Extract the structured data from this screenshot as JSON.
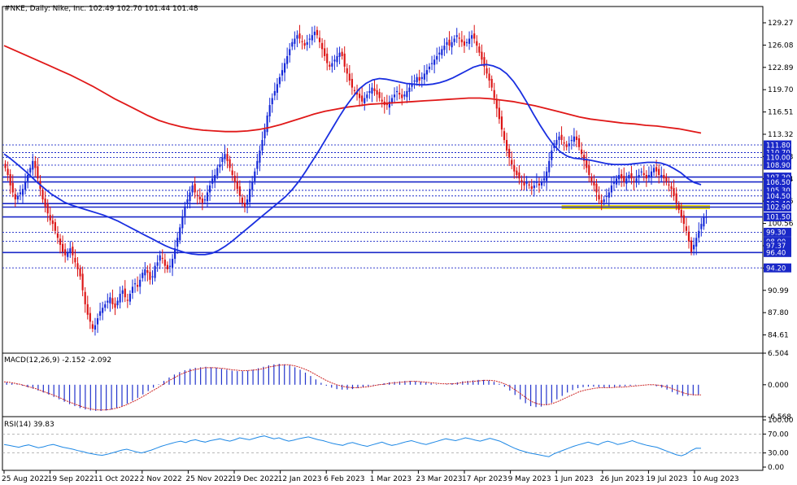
{
  "header": {
    "symbol": "#NKE",
    "timeframe": "Daily",
    "name": "Nike, Inc.",
    "ohlc": "102.49 102.70 101.44 101.48"
  },
  "colors": {
    "up": "#1428d8",
    "down": "#dc1414",
    "ma_fast": "#1a2fe0",
    "ma_slow": "#e01818",
    "level_tag": "#1a28c8",
    "highlight": "#e6d400",
    "macd_hist": "#2233cc",
    "macd_signal": "#cc2222",
    "rsi": "#1e88e5",
    "grid_dots": "#9090a0"
  },
  "chart_data": [
    {
      "type": "candlestick",
      "title": "#NKE, Daily: Nike, Inc. 102.49 102.70 101.44 101.48",
      "ylim": [
        82.0,
        131.6
      ],
      "y_ticks": [
        "129.27",
        "126.08",
        "122.89",
        "119.70",
        "116.51",
        "113.32",
        "110.13",
        "106.94",
        "103.76",
        "100.56",
        "97.37",
        "94.18",
        "90.99",
        "87.80",
        "84.61"
      ],
      "x_ticks": [
        "25 Aug 2022",
        "19 Sep 2022",
        "11 Oct 2022",
        "2 Nov 2022",
        "25 Nov 2022",
        "19 Dec 2022",
        "12 Jan 2023",
        "6 Feb 2023",
        "1 Mar 2023",
        "23 Mar 2023",
        "17 Apr 2023",
        "9 May 2023",
        "1 Jun 2023",
        "26 Jun 2023",
        "19 Jul 2023",
        "10 Aug 2023"
      ],
      "horizontal_levels": [
        {
          "label": "111.80",
          "value": 111.8,
          "style": "dotted"
        },
        {
          "label": "110.70",
          "value": 110.7,
          "style": "dotted"
        },
        {
          "label": "110.00",
          "value": 110.0,
          "style": "dotted"
        },
        {
          "label": "108.90",
          "value": 108.9,
          "style": "dotted"
        },
        {
          "label": "107.20",
          "value": 107.2,
          "style": "solid"
        },
        {
          "label": "106.50",
          "value": 106.5,
          "style": "solid"
        },
        {
          "label": "105.30",
          "value": 105.3,
          "style": "dotted"
        },
        {
          "label": "104.50",
          "value": 104.5,
          "style": "dotted"
        },
        {
          "label": "103.40",
          "value": 103.4,
          "style": "solid"
        },
        {
          "label": "102.90",
          "value": 102.9,
          "style": "solid"
        },
        {
          "label": "101.50",
          "value": 101.5,
          "style": "solid"
        },
        {
          "label": "99.30",
          "value": 99.3,
          "style": "dotted"
        },
        {
          "label": "98.00",
          "value": 98.0,
          "style": "dotted"
        },
        {
          "label": "97.37",
          "value": 97.37,
          "style": "none"
        },
        {
          "label": "96.40",
          "value": 96.4,
          "style": "solid"
        },
        {
          "label": "94.20",
          "value": 94.2,
          "style": "dotted"
        }
      ],
      "highlight_level": 102.9,
      "close_series": [
        108.5,
        107.5,
        106,
        105,
        104,
        104.5,
        105,
        105.5,
        106.5,
        107.5,
        108.5,
        109.5,
        108.5,
        107,
        105.5,
        104,
        103,
        102,
        101,
        100.5,
        99.5,
        98.5,
        97.5,
        96.5,
        96,
        96.5,
        97,
        96,
        95,
        94,
        93,
        91,
        89,
        87.5,
        86.5,
        85.5,
        86,
        87,
        88,
        88.5,
        89,
        89.5,
        90,
        89,
        88.5,
        89.5,
        90.5,
        91,
        90,
        89.5,
        90.5,
        91.5,
        92,
        91.5,
        92.5,
        93.5,
        94,
        93.5,
        92.5,
        93,
        94.5,
        95,
        96,
        95.5,
        94.5,
        94,
        94.5,
        95.5,
        97,
        98.5,
        100,
        101.5,
        103,
        104,
        105,
        106,
        105,
        104.5,
        104,
        103.5,
        104,
        105,
        106,
        107,
        107.5,
        108.5,
        109,
        110,
        110.5,
        109.5,
        108.5,
        107.5,
        106.5,
        105.5,
        104.5,
        103.5,
        103,
        104,
        105.5,
        106.5,
        108,
        109.5,
        111,
        112.5,
        114,
        116,
        117.5,
        118.5,
        119.5,
        120.5,
        121.5,
        122.5,
        123.5,
        124.5,
        125.5,
        126.5,
        127,
        127.5,
        127,
        126.5,
        126,
        126.5,
        127,
        127.5,
        128,
        127.5,
        126.5,
        125.5,
        124.5,
        123.5,
        123,
        123.5,
        124,
        124.5,
        125,
        124.5,
        123,
        122,
        121,
        120,
        119.5,
        119,
        118.5,
        118,
        118.5,
        119,
        119.5,
        120,
        119.5,
        119,
        118.5,
        118,
        117.5,
        117.5,
        118,
        118.5,
        119,
        119.5,
        119,
        118.5,
        119,
        119.5,
        120,
        120.5,
        121,
        121.5,
        121,
        121.5,
        122,
        122.5,
        123,
        123.5,
        124,
        124.5,
        125,
        125.5,
        126,
        126.5,
        126,
        126.5,
        127,
        127.5,
        127,
        126.5,
        126,
        126.5,
        127,
        127.5,
        127,
        126,
        125,
        124,
        123,
        122,
        121,
        120,
        118.5,
        117,
        115.5,
        114,
        112.5,
        111,
        110,
        109,
        108,
        107.5,
        107,
        106.5,
        106,
        106.5,
        106,
        105.5,
        106,
        106.5,
        106,
        106.5,
        107,
        108,
        109.5,
        111,
        112,
        112.5,
        113,
        112.5,
        112,
        111.5,
        112,
        112.5,
        113,
        112.5,
        111.5,
        110.5,
        109.5,
        108.5,
        107.5,
        106.5,
        106,
        105,
        104,
        103.5,
        104,
        104.5,
        105,
        106,
        106.5,
        107,
        107.5,
        107,
        106.5,
        107,
        107.5,
        107,
        106.5,
        107,
        107.5,
        108,
        107.5,
        107,
        107.5,
        108,
        108.5,
        108,
        107.5,
        107.5,
        107,
        106.5,
        106,
        105.5,
        104.5,
        103.5,
        102.5,
        101.5,
        100.5,
        99.5,
        98,
        96.5,
        97.5,
        98.5,
        99.5,
        100.5,
        101.5,
        101.48
      ],
      "ma_fast": {
        "name": "",
        "values": [
          110.5,
          109.8,
          109.0,
          108.2,
          107.3,
          106.4,
          105.6,
          104.8,
          104.2,
          103.6,
          103.2,
          102.9,
          102.6,
          102.3,
          102.0,
          101.7,
          101.3,
          100.9,
          100.4,
          99.9,
          99.4,
          98.9,
          98.4,
          97.9,
          97.4,
          97.0,
          96.7,
          96.4,
          96.2,
          96.1,
          96.1,
          96.3,
          96.7,
          97.3,
          98.0,
          98.8,
          99.6,
          100.4,
          101.2,
          102.0,
          102.8,
          103.6,
          104.4,
          105.4,
          106.6,
          108.0,
          109.5,
          111.0,
          112.6,
          114.2,
          115.8,
          117.3,
          118.6,
          119.8,
          120.6,
          121.1,
          121.3,
          121.2,
          121.0,
          120.8,
          120.6,
          120.5,
          120.4,
          120.4,
          120.5,
          120.7,
          121.0,
          121.4,
          121.9,
          122.4,
          122.9,
          123.2,
          123.3,
          123.1,
          122.7,
          122.0,
          120.9,
          119.5,
          117.9,
          116.2,
          114.6,
          113.1,
          111.8,
          110.8,
          110.2,
          109.9,
          109.8,
          109.7,
          109.5,
          109.3,
          109.1,
          109.0,
          109.0,
          109.0,
          109.1,
          109.2,
          109.3,
          109.3,
          109.2,
          108.9,
          108.4,
          107.8,
          107.0,
          106.4,
          106.1
        ]
      },
      "ma_slow": {
        "name": "",
        "values": [
          126.0,
          125.3,
          124.6,
          123.9,
          123.2,
          122.5,
          121.8,
          121.0,
          120.2,
          119.3,
          118.4,
          117.6,
          116.8,
          116.0,
          115.3,
          114.8,
          114.4,
          114.1,
          113.9,
          113.8,
          113.7,
          113.7,
          113.8,
          114.0,
          114.3,
          114.7,
          115.2,
          115.7,
          116.2,
          116.6,
          116.9,
          117.2,
          117.4,
          117.6,
          117.7,
          117.8,
          117.9,
          118.0,
          118.1,
          118.2,
          118.3,
          118.4,
          118.5,
          118.5,
          118.4,
          118.2,
          118.0,
          117.7,
          117.4,
          117.0,
          116.6,
          116.2,
          115.8,
          115.5,
          115.3,
          115.1,
          114.9,
          114.8,
          114.6,
          114.5,
          114.3,
          114.1,
          113.8,
          113.5
        ]
      },
      "note_candles": "candles are drawn from close_series"
    },
    {
      "type": "bar",
      "title": "MACD(12,26,9) -2.152 -2.092",
      "ylim": [
        -6.568,
        6.504
      ],
      "y_ticks": [
        "6.504",
        "0.000",
        "-6.568"
      ],
      "series": [
        {
          "name": "",
          "values": [
            0.5,
            0.3,
            0.1,
            -0.2,
            -0.5,
            -0.8,
            -1.2,
            -1.6,
            -2.0,
            -2.5,
            -3.0,
            -3.5,
            -4.0,
            -4.4,
            -4.8,
            -5.1,
            -5.3,
            -5.4,
            -5.4,
            -5.3,
            -5.1,
            -4.8,
            -4.4,
            -3.9,
            -3.3,
            -2.7,
            -2.0,
            -1.3,
            -0.6,
            0.1,
            0.8,
            1.5,
            2.1,
            2.6,
            3.0,
            3.3,
            3.5,
            3.6,
            3.7,
            3.6,
            3.5,
            3.3,
            3.1,
            2.9,
            2.8,
            2.8,
            2.9,
            3.1,
            3.4,
            3.7,
            4.0,
            4.2,
            4.3,
            4.2,
            4.0,
            3.6,
            3.1,
            2.5,
            1.8,
            1.1,
            0.4,
            -0.2,
            -0.6,
            -0.9,
            -1.0,
            -1.0,
            -0.9,
            -0.7,
            -0.5,
            -0.3,
            -0.1,
            0.1,
            0.3,
            0.5,
            0.6,
            0.7,
            0.8,
            0.8,
            0.7,
            0.6,
            0.5,
            0.3,
            0.1,
            0.0,
            0.1,
            0.3,
            0.5,
            0.7,
            0.8,
            0.9,
            1.0,
            1.0,
            0.9,
            0.6,
            0.2,
            -0.4,
            -1.2,
            -2.1,
            -3.0,
            -3.8,
            -4.4,
            -4.6,
            -4.5,
            -4.2,
            -3.7,
            -3.0,
            -2.3,
            -1.6,
            -1.1,
            -0.7,
            -0.5,
            -0.4,
            -0.4,
            -0.5,
            -0.6,
            -0.6,
            -0.5,
            -0.4,
            -0.3,
            -0.2,
            -0.1,
            0.0,
            0.0,
            -0.1,
            -0.3,
            -0.6,
            -1.0,
            -1.5,
            -2.0,
            -2.3,
            -2.3,
            -2.2,
            -2.15
          ]
        },
        {
          "name": "",
          "values": [
            0.6,
            0.5,
            0.3,
            0.1,
            -0.2,
            -0.5,
            -0.8,
            -1.2,
            -1.6,
            -2.0,
            -2.4,
            -2.9,
            -3.4,
            -3.8,
            -4.2,
            -4.6,
            -4.9,
            -5.1,
            -5.2,
            -5.2,
            -5.1,
            -4.9,
            -4.6,
            -4.2,
            -3.7,
            -3.2,
            -2.6,
            -2.0,
            -1.3,
            -0.7,
            0.0,
            0.7,
            1.3,
            1.9,
            2.4,
            2.8,
            3.1,
            3.3,
            3.5,
            3.5,
            3.5,
            3.4,
            3.3,
            3.1,
            3.0,
            2.9,
            2.9,
            3.0,
            3.1,
            3.3,
            3.6,
            3.8,
            4.0,
            4.1,
            4.1,
            3.9,
            3.6,
            3.2,
            2.7,
            2.1,
            1.5,
            0.9,
            0.4,
            0.0,
            -0.3,
            -0.5,
            -0.6,
            -0.6,
            -0.5,
            -0.4,
            -0.2,
            0.0,
            0.1,
            0.3,
            0.4,
            0.5,
            0.6,
            0.7,
            0.7,
            0.6,
            0.5,
            0.4,
            0.3,
            0.2,
            0.2,
            0.2,
            0.3,
            0.5,
            0.6,
            0.7,
            0.8,
            0.9,
            0.9,
            0.8,
            0.5,
            0.1,
            -0.5,
            -1.2,
            -2.0,
            -2.8,
            -3.5,
            -3.9,
            -4.1,
            -4.1,
            -3.8,
            -3.4,
            -2.9,
            -2.4,
            -1.9,
            -1.4,
            -1.1,
            -0.9,
            -0.7,
            -0.6,
            -0.6,
            -0.6,
            -0.5,
            -0.5,
            -0.4,
            -0.3,
            -0.2,
            -0.1,
            0.0,
            0.0,
            -0.1,
            -0.3,
            -0.6,
            -1.0,
            -1.4,
            -1.8,
            -2.0,
            -2.1,
            -2.09
          ]
        }
      ]
    },
    {
      "type": "line",
      "title": "RSI(14) 39.83",
      "ylim": [
        0,
        100
      ],
      "y_ticks": [
        "100.00",
        "70.00",
        "30.00",
        "0.00"
      ],
      "levels": [
        70,
        30
      ],
      "series": [
        {
          "name": "",
          "values": [
            48,
            46,
            44,
            42,
            45,
            47,
            44,
            41,
            43,
            46,
            48,
            45,
            42,
            40,
            38,
            35,
            33,
            30,
            28,
            26,
            25,
            27,
            30,
            33,
            36,
            38,
            35,
            32,
            30,
            33,
            36,
            40,
            44,
            47,
            50,
            53,
            55,
            52,
            56,
            58,
            55,
            53,
            56,
            58,
            60,
            57,
            55,
            58,
            62,
            60,
            58,
            61,
            64,
            66,
            63,
            60,
            62,
            58,
            55,
            57,
            60,
            62,
            64,
            61,
            58,
            56,
            53,
            50,
            48,
            46,
            50,
            52,
            49,
            46,
            44,
            47,
            50,
            53,
            49,
            46,
            48,
            51,
            54,
            56,
            53,
            50,
            48,
            51,
            54,
            57,
            60,
            58,
            56,
            59,
            62,
            60,
            57,
            55,
            58,
            61,
            58,
            55,
            50,
            45,
            40,
            36,
            33,
            30,
            28,
            26,
            24,
            22,
            28,
            32,
            36,
            40,
            44,
            47,
            50,
            53,
            50,
            47,
            52,
            55,
            52,
            48,
            50,
            53,
            56,
            52,
            49,
            46,
            44,
            42,
            38,
            34,
            30,
            26,
            24,
            28,
            35,
            40,
            39.83
          ]
        }
      ]
    }
  ]
}
